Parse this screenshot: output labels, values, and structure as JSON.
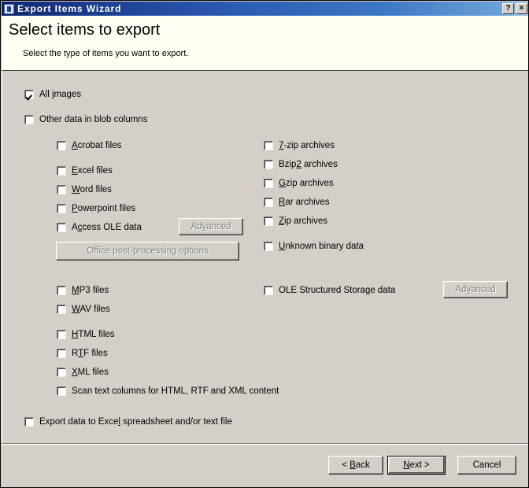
{
  "window": {
    "title": "Export Items Wizard",
    "icon": "wizard-icon",
    "help_label": "?",
    "close_label": "×"
  },
  "header": {
    "title": "Select items to export",
    "subtitle": "Select the type of items you want to export."
  },
  "options": {
    "all_images": {
      "label": "All images",
      "mnemonic": "i",
      "checked": true
    },
    "other_blob": {
      "label": "Other data in blob columns",
      "mnemonic": "",
      "checked": false
    },
    "left_column": [
      {
        "label": "Acrobat files",
        "mnemonic": "A",
        "checked": false
      },
      {
        "label": "Excel files",
        "mnemonic": "E",
        "checked": false
      },
      {
        "label": "Word files",
        "mnemonic": "W",
        "checked": false
      },
      {
        "label": "Powerpoint files",
        "mnemonic": "P",
        "checked": false
      },
      {
        "label": "Access OLE data",
        "mnemonic": "c",
        "checked": false
      }
    ],
    "right_column": [
      {
        "label": "7-zip archives",
        "mnemonic": "7",
        "checked": false
      },
      {
        "label": "Bzip2 archives",
        "mnemonic": "2",
        "checked": false
      },
      {
        "label": "Gzip archives",
        "mnemonic": "G",
        "checked": false
      },
      {
        "label": "Rar archives",
        "mnemonic": "R",
        "checked": false
      },
      {
        "label": "Zip archives",
        "mnemonic": "Z",
        "checked": false
      }
    ],
    "unknown_binary": {
      "label": "Unknown binary data",
      "mnemonic": "U",
      "checked": false
    },
    "media": [
      {
        "label": "MP3 files",
        "mnemonic": "M",
        "checked": false
      },
      {
        "label": "WAV files",
        "mnemonic": "W",
        "checked": false
      }
    ],
    "ole_storage": {
      "label": "OLE Structured Storage data",
      "mnemonic": "",
      "checked": false
    },
    "text_formats": [
      {
        "label": "HTML files",
        "mnemonic": "H",
        "checked": false
      },
      {
        "label": "RTF files",
        "mnemonic": "T",
        "checked": false
      },
      {
        "label": "XML files",
        "mnemonic": "X",
        "checked": false
      }
    ],
    "scan_text": {
      "label": "Scan text columns for HTML, RTF and XML content",
      "mnemonic": "",
      "checked": false
    },
    "export_excel": {
      "label": "Export data to Excel spreadsheet and/or text file",
      "mnemonic": "l",
      "checked": false
    }
  },
  "buttons": {
    "advanced_access": {
      "label": "Advanced",
      "mnemonic": "v",
      "disabled": true
    },
    "office_post": {
      "label": "Office post-processing options",
      "mnemonic": "",
      "disabled": true
    },
    "advanced_ole": {
      "label": "Advanced",
      "mnemonic": "v",
      "disabled": true
    },
    "back": {
      "label": "< Back",
      "mnemonic": "B",
      "disabled": false
    },
    "next": {
      "label": "Next >",
      "mnemonic": "N",
      "disabled": false,
      "default": true
    },
    "cancel": {
      "label": "Cancel",
      "mnemonic": "",
      "disabled": false
    }
  }
}
